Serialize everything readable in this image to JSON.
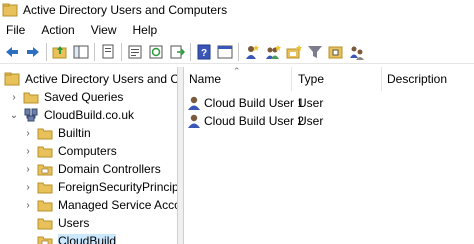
{
  "window": {
    "title": "Active Directory Users and Computers"
  },
  "menu": [
    "File",
    "Action",
    "View",
    "Help"
  ],
  "toolbar": {
    "icons": [
      "back-arrow-icon",
      "forward-arrow-icon",
      "up-folder-icon",
      "show-hide-tree-icon",
      "copy-icon",
      "delete-icon",
      "properties-icon",
      "refresh-icon",
      "export-list-icon",
      "help-icon",
      "console-tree-icon",
      "new-user-icon",
      "new-group-icon",
      "new-ou-icon",
      "filter-icon",
      "add-to-group-icon",
      "delegate-icon"
    ]
  },
  "tree": {
    "root": "Active Directory Users and Com",
    "items": [
      {
        "label": "Saved Queries",
        "icon": "folder-icon",
        "expanded": false
      },
      {
        "label": "CloudBuild.co.uk",
        "icon": "domain-icon",
        "expanded": true
      },
      {
        "label": "Builtin",
        "icon": "folder-icon",
        "expanded": false
      },
      {
        "label": "Computers",
        "icon": "folder-icon",
        "expanded": false
      },
      {
        "label": "Domain Controllers",
        "icon": "ou-icon",
        "expanded": false
      },
      {
        "label": "ForeignSecurityPrincipals",
        "icon": "folder-icon",
        "expanded": false
      },
      {
        "label": "Managed Service Accour",
        "icon": "folder-icon",
        "expanded": false
      },
      {
        "label": "Users",
        "icon": "folder-icon",
        "expanded": false
      },
      {
        "label": "CloudBuild",
        "icon": "ou-icon",
        "selected": true
      }
    ]
  },
  "list": {
    "columns": [
      "Name",
      "Type",
      "Description"
    ],
    "rows": [
      {
        "name": "Cloud Build User 1",
        "type": "User",
        "description": ""
      },
      {
        "name": "Cloud Build User 2",
        "type": "User",
        "description": ""
      }
    ]
  },
  "colors": {
    "folder": "#e8c15a",
    "selection": "#cce8ff",
    "accent": "#2e6fbf"
  }
}
